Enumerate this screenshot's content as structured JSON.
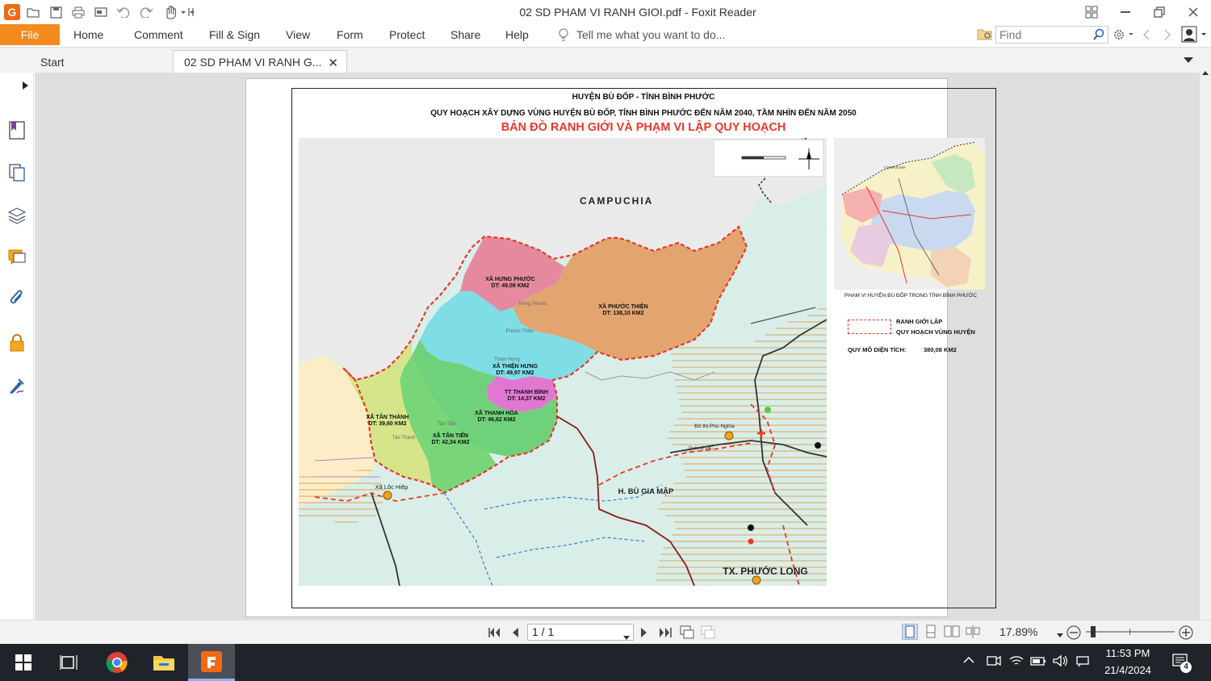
{
  "window": {
    "title": "02 SD PHAM VI RANH GIOI.pdf - Foxit Reader",
    "app_logo": "G"
  },
  "menu": {
    "file": "File",
    "items": [
      "Home",
      "Comment",
      "Fill & Sign",
      "View",
      "Form",
      "Protect",
      "Share",
      "Help"
    ],
    "tell_me": "Tell me what you want to do...",
    "find_placeholder": "Find"
  },
  "tabs": {
    "start": "Start",
    "document": "02 SD PHAM VI RANH G..."
  },
  "document": {
    "header_line1": "HUYỆN BÙ ĐỐP - TỈNH BÌNH PHƯỚC",
    "header_line2": "QUY HOẠCH XÂY DỰNG VÙNG HUYỆN BÙ ĐỐP, TỈNH BÌNH PHƯỚC ĐẾN NĂM 2040, TẦM NHÌN ĐẾN NĂM 2050",
    "map_title": "BẢN ĐỒ RANH GIỚI VÀ PHẠM VI LẬP QUY HOẠCH",
    "map_labels": {
      "country": "CAMPUCHIA",
      "hung_phuoc": "XÃ HƯNG PHƯỚC",
      "hung_phuoc_area": "DT: 49,08 KM2",
      "phuoc_thien": "XÃ PHƯỚC THIỆN",
      "phuoc_thien_area": "DT: 138,10 KM2",
      "thien_hung": "XÃ THIỆN HƯNG",
      "thien_hung_area": "DT: 49,97 KM2",
      "thanh_binh": "TT THANH BÌNH",
      "thanh_binh_area": "DT: 14,37 KM2",
      "thanh_hoa": "XÃ THANH HÒA",
      "thanh_hoa_area": "DT: 46,62 KM2",
      "tan_thanh": "XÃ TÂN THÀNH",
      "tan_thanh_area": "DT: 39,60 KM2",
      "tan_tien": "XÃ TÂN TIẾN",
      "tan_tien_area": "DT: 42,34 KM2",
      "bu_gia_map": "H. BÙ GIA MẬP",
      "phuoc_long": "TX. PHƯỚC LONG",
      "loc_hiep": "Xã Lộc Hiệp",
      "do_thi_phu_nghia": "Đô thị Phú Nghĩa",
      "ql14c": "Quốc lộ 14C",
      "hung_phuoc_small": "Hưng Phước",
      "phuoc_thien_small": "Phước Thiện",
      "thien_hung_small": "Thiện Hưng",
      "tan_tien_small": "Tân Tiến",
      "tan_thanh_small": "Tân Thành"
    },
    "inset_caption": "PHẠM VI HUYỆN BÙ ĐỐP TRONG TỈNH BÌNH PHƯỚC",
    "inset_labels": {
      "campuchia": "CAMPUCHIA"
    },
    "legend_line1": "RANH GIỚI LẬP",
    "legend_line2": "QUY HOẠCH VÙNG HUYỆN",
    "legend_scale_label": "QUY MÔ DIỆN TÍCH:",
    "legend_scale_value": "380,08 KM2"
  },
  "statusbar": {
    "page": "1 / 1",
    "zoom": "17.89%"
  },
  "taskbar": {
    "time": "11:53 PM",
    "date": "21/4/2024",
    "notifications": "4"
  },
  "colors": {
    "accent": "#f28a1f",
    "map_red": "#e8372c",
    "hung_phuoc": "#e58a9e",
    "phuoc_thien": "#e3a56f",
    "thien_hung": "#7fdde6",
    "thanh_binh": "#e078d2",
    "thanh_hoa": "#6fd27a",
    "tan_tien": "#78d679",
    "tan_thanh": "#d6e58a"
  }
}
